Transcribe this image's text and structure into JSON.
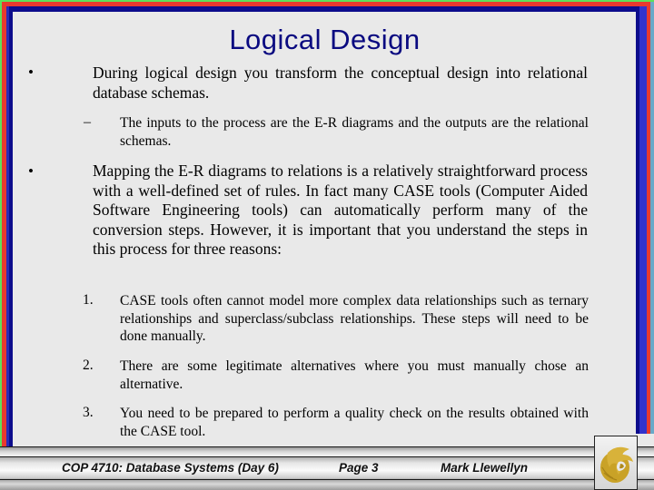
{
  "slide": {
    "title": "Logical Design",
    "bullets": [
      {
        "marker": "•",
        "text": "During logical design you transform the conceptual design into relational database schemas.",
        "sub": [
          {
            "marker": "–",
            "text": "The inputs to the process are the E-R diagrams and the outputs are the relational schemas."
          }
        ]
      },
      {
        "marker": "•",
        "text": "Mapping the E-R diagrams to relations is a relatively straightforward process with a well-defined set of rules.  In fact many CASE tools (Computer Aided Software Engineering tools) can automatically perform many of the conversion steps.  However, it is important that you understand the steps in this process for three reasons:"
      }
    ],
    "reasons": [
      {
        "marker": "1.",
        "text": "CASE tools often cannot model more complex data relationships such as ternary relationships and superclass/subclass relationships.  These steps will need to be done manually."
      },
      {
        "marker": "2.",
        "text": "There are some legitimate alternatives where you must manually chose an alternative."
      },
      {
        "marker": "3.",
        "text": "You need to be prepared to perform a quality check on the results obtained with the CASE tool."
      }
    ]
  },
  "footer": {
    "course": "COP 4710: Database Systems  (Day 6)",
    "page": "Page 3",
    "author": "Mark Llewellyn",
    "logo_icon": "pegasus-logo-icon"
  },
  "colors": {
    "title": "#0a0a80",
    "background": "#e9e9e9",
    "border_green": "#5ee15a",
    "border_red": "#e83a2e",
    "border_navy": "#0c0c8c",
    "border_blue": "#3333cc",
    "logo_gold": "#c9a227"
  }
}
